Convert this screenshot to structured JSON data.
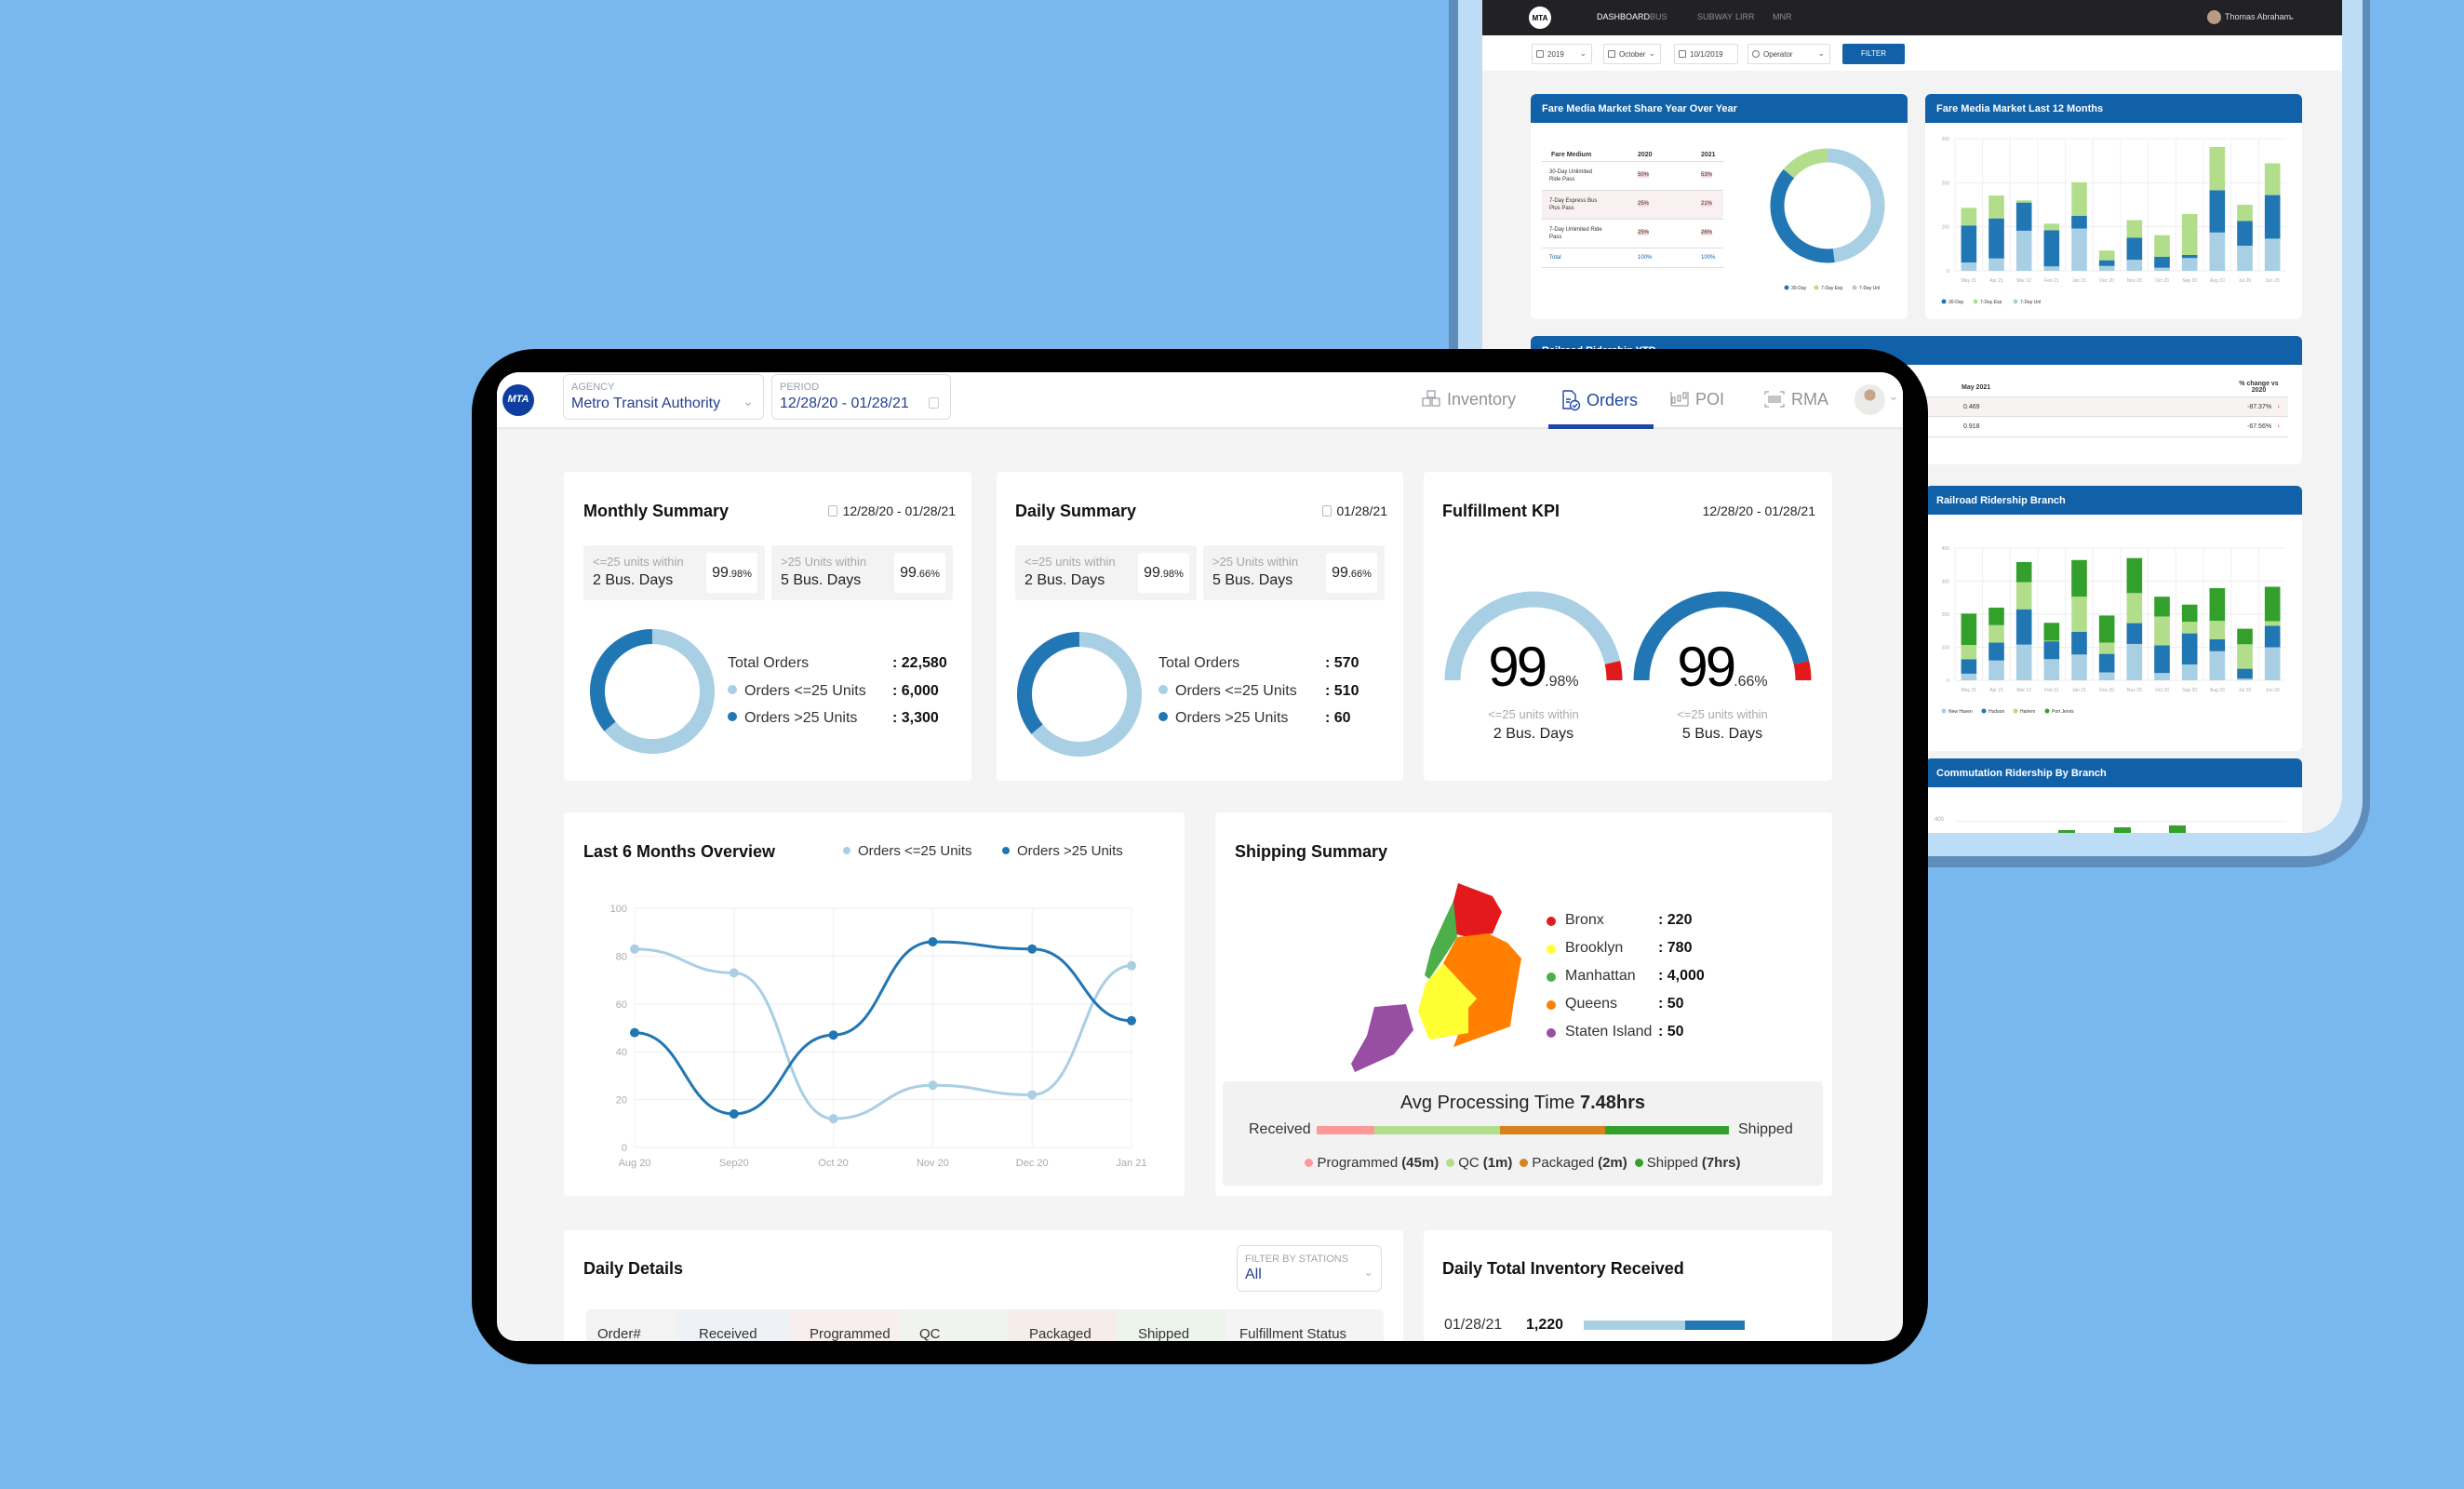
{
  "colors": {
    "background": "#79b8ee",
    "brand_blue": "#1161a9",
    "dark_blue": "#2176b4",
    "light_blue": "#a8cfe3",
    "light_green": "#b2de8c",
    "green": "#33a02c",
    "red": "#e31a1c"
  },
  "back_dashboard": {
    "logo": "MTA",
    "nav": [
      "DASHBOARD",
      "BUS",
      "SUBWAY",
      "LIRR",
      "MNR"
    ],
    "user": "Thomas Abraham",
    "filters": {
      "year": "2019",
      "month": "October",
      "date": "10/1/2019",
      "operator": "Operator",
      "filter_button": "FILTER"
    },
    "fare_share": {
      "title": "Fare Media Market Share Year Over Year",
      "columns": [
        "Fare Medium",
        "2020",
        "2021"
      ],
      "rows": [
        {
          "medium": "30-Day Unlimited Ride Pass",
          "y2020": "50%",
          "y2021": "53%"
        },
        {
          "medium": "7-Day Express Bus Plus Pass",
          "y2020": "25%",
          "y2021": "21%"
        },
        {
          "medium": "7-Day Unlimited Ride Pass",
          "y2020": "25%",
          "y2021": "26%"
        }
      ],
      "total": {
        "label": "Total",
        "y2020": "100%",
        "y2021": "100%"
      },
      "donut": [
        {
          "name": "30-Day",
          "share": 0.38,
          "color": "#2176b4"
        },
        {
          "name": "7-Day Exp",
          "share": 0.14,
          "color": "#b2de8c"
        },
        {
          "name": "7-Day Unl",
          "share": 0.48,
          "color": "#a8cfe3"
        }
      ]
    },
    "ytd": {
      "title": "Railroad Ridership YTD",
      "columns": [
        "May 2021",
        "% change vs 2020"
      ],
      "rows": [
        {
          "value": "0.469",
          "change": "-87.37%"
        },
        {
          "value": "0.918",
          "change": "-67.56%"
        }
      ]
    },
    "commutation": {
      "title": "Commutation Ridership By Branch",
      "ytick": "400"
    }
  },
  "chart_data": [
    {
      "type": "bar",
      "stacked": true,
      "title": "Fare Media Market Last 12 Months",
      "categories": [
        "May 21",
        "Apr 21",
        "Mar 12",
        "Feb 21",
        "Jan 21",
        "Dec 20",
        "Nov 20",
        "Oct 20",
        "Sep 20",
        "Aug 20",
        "Jul 20",
        "Jun 20"
      ],
      "ylim": [
        0,
        300
      ],
      "yticks": [
        0,
        100,
        200,
        300
      ],
      "grid": true,
      "legend": "bottom-left",
      "series": [
        {
          "name": "7-Day Unl",
          "color": "#a8cfe3",
          "values": [
            19,
            28,
            91,
            10,
            96,
            11,
            25,
            7,
            29,
            87,
            57,
            73
          ]
        },
        {
          "name": "30-Day",
          "color": "#2176b4",
          "values": [
            84,
            91,
            64,
            82,
            29,
            13,
            50,
            25,
            7,
            96,
            56,
            99
          ]
        },
        {
          "name": "7-Day Exp",
          "color": "#b2de8c",
          "values": [
            40,
            52,
            5,
            15,
            76,
            22,
            40,
            49,
            93,
            98,
            37,
            72
          ]
        }
      ],
      "legend_order": [
        "30-Day",
        "7-Day Exp",
        "7-Day Unl"
      ]
    },
    {
      "type": "bar",
      "stacked": true,
      "title": "Railroad Ridership Branch",
      "categories": [
        "May 21",
        "Apr 21",
        "Mar 12",
        "Feb 21",
        "Jan 21",
        "Dec 20",
        "Nov 20",
        "Oct 20",
        "Sep 20",
        "Aug 20",
        "Jul 20",
        "Jun 20"
      ],
      "ylim": [
        0,
        400
      ],
      "yticks": [
        0,
        100,
        200,
        300,
        400
      ],
      "grid": true,
      "legend": "bottom-left",
      "series": [
        {
          "name": "New Haven",
          "color": "#a8cfe3",
          "values": [
            20,
            60,
            108,
            64,
            78,
            24,
            110,
            22,
            48,
            88,
            5,
            100
          ]
        },
        {
          "name": "Hudson",
          "color": "#2176b4",
          "values": [
            44,
            54,
            107,
            54,
            69,
            56,
            63,
            84,
            94,
            36,
            30,
            65
          ]
        },
        {
          "name": "Harlem",
          "color": "#b2de8c",
          "values": [
            43,
            53,
            82,
            2,
            106,
            34,
            91,
            87,
            35,
            56,
            74,
            14
          ]
        },
        {
          "name": "Port Jervis",
          "color": "#33a02c",
          "values": [
            95,
            53,
            61,
            54,
            111,
            82,
            106,
            60,
            52,
            99,
            47,
            104
          ]
        }
      ]
    },
    {
      "type": "line",
      "title": "Last 6 Months Overview",
      "categories": [
        "Aug 20",
        "Sep20",
        "Oct 20",
        "Nov 20",
        "Dec 20",
        "Jan 21"
      ],
      "ylim": [
        0,
        100
      ],
      "yticks": [
        0,
        20,
        40,
        60,
        80,
        100
      ],
      "grid": true,
      "legend": "top",
      "series": [
        {
          "name": "Orders <=25 Units",
          "color": "#a8cfe3",
          "values": [
            83,
            73,
            12,
            26,
            22,
            76
          ]
        },
        {
          "name": "Orders >25 Units",
          "color": "#2176b4",
          "values": [
            48,
            14,
            47,
            86,
            83,
            53
          ]
        }
      ]
    }
  ],
  "header": {
    "logo": "MTA",
    "agency": {
      "label": "AGENCY",
      "value": "Metro Transit Authority"
    },
    "period": {
      "label": "PERIOD",
      "value": "12/28/20 - 01/28/21"
    },
    "nav": [
      {
        "label": "Inventory",
        "icon": "boxes-icon"
      },
      {
        "label": "Orders",
        "icon": "orders-doc-icon",
        "active": true
      },
      {
        "label": "POI",
        "icon": "poi-icon"
      },
      {
        "label": "RMA",
        "icon": "barcode-icon"
      }
    ]
  },
  "monthly": {
    "title": "Monthly Summary",
    "date": "12/28/20 - 01/28/21",
    "stats": [
      {
        "l1": "<=25 units within",
        "l2": "2 Bus. Days",
        "pct": "99",
        "pct_small": ".98%"
      },
      {
        "l1": ">25 Units within",
        "l2": "5 Bus. Days",
        "pct": "99",
        "pct_small": ".66%"
      }
    ],
    "legend": [
      {
        "label": "Total Orders",
        "value": ": 22,580"
      },
      {
        "label": "Orders <=25 Units",
        "value": ": 6,000"
      },
      {
        "label": "Orders >25 Units",
        "value": ": 3,300"
      }
    ],
    "donut_share_gt25": 0.36
  },
  "daily": {
    "title": "Daily Summary",
    "date": "01/28/21",
    "stats": [
      {
        "l1": "<=25 units within",
        "l2": "2 Bus. Days",
        "pct": "99",
        "pct_small": ".98%"
      },
      {
        "l1": ">25 Units within",
        "l2": "5 Bus. Days",
        "pct": "99",
        "pct_small": ".66%"
      }
    ],
    "legend": [
      {
        "label": "Total Orders",
        "value": ": 570"
      },
      {
        "label": "Orders <=25 Units",
        "value": ": 510"
      },
      {
        "label": "Orders >25 Units",
        "value": ": 60"
      }
    ],
    "donut_share_gt25": 0.36
  },
  "kpi": {
    "title": "Fulfillment KPI",
    "date": "12/28/20 - 01/28/21",
    "gauges": [
      {
        "big": "99",
        "small": ".98%",
        "value": 99.98,
        "l1": "<=25 units within",
        "l2": "2 Bus. Days",
        "color": "#a8cfe3"
      },
      {
        "big": "99",
        "small": ".66%",
        "value": 99.66,
        "l1": "<=25 units within",
        "l2": "5 Bus. Days",
        "color": "#2176b4"
      }
    ]
  },
  "shipping": {
    "title": "Shipping Summary",
    "boroughs": [
      {
        "name": "Bronx",
        "value": ": 220",
        "color": "#e31a1c"
      },
      {
        "name": "Brooklyn",
        "value": ": 780",
        "color": "#ffff33"
      },
      {
        "name": "Manhattan",
        "value": ": 4,000",
        "color": "#4daf4a"
      },
      {
        "name": "Queens",
        "value": ": 50",
        "color": "#ff7f00"
      },
      {
        "name": "Staten Island",
        "value": ": 50",
        "color": "#984ea3"
      }
    ],
    "processing": {
      "title": "Avg Processing Time",
      "value": "7.48hrs",
      "start": "Received",
      "end": "Shipped",
      "stages": [
        {
          "name": "Programmed",
          "time": "(45m)",
          "color": "#fb9a99",
          "share": 14
        },
        {
          "name": "QC",
          "time": "(1m)",
          "color": "#b2de8c",
          "share": 30.5
        },
        {
          "name": "Packaged",
          "time": "(2m)",
          "color": "#d6821f",
          "share": 25.5
        },
        {
          "name": "Shipped",
          "time": "(7hrs)",
          "color": "#33a02c",
          "share": 30
        }
      ]
    }
  },
  "daily_details": {
    "title": "Daily Details",
    "filter": {
      "label": "FILTER BY STATIONS",
      "value": "All"
    },
    "columns": [
      "Order#",
      "Received",
      "Programmed",
      "QC",
      "Packaged",
      "Shipped",
      "Fulfillment Status"
    ]
  },
  "inventory_received": {
    "title": "Daily Total Inventory Received",
    "rows": [
      {
        "date": "01/28/21",
        "value": "1,220",
        "share_light": 0.63
      }
    ]
  }
}
